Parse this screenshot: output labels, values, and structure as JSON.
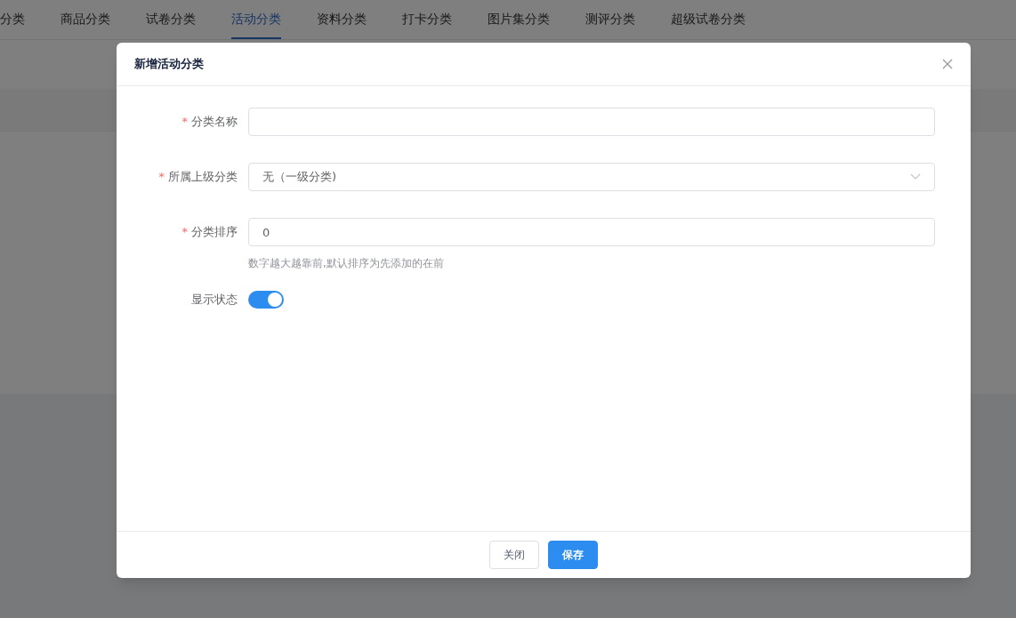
{
  "tabs": [
    {
      "label": "分类",
      "selected": false
    },
    {
      "label": "商品分类",
      "selected": false
    },
    {
      "label": "试卷分类",
      "selected": false
    },
    {
      "label": "活动分类",
      "selected": true
    },
    {
      "label": "资料分类",
      "selected": false
    },
    {
      "label": "打卡分类",
      "selected": false
    },
    {
      "label": "图片集分类",
      "selected": false
    },
    {
      "label": "测评分类",
      "selected": false
    },
    {
      "label": "超级试卷分类",
      "selected": false
    }
  ],
  "dialog": {
    "title": "新增活动分类",
    "fields": [
      {
        "kind": "text",
        "label": "分类名称",
        "required_mark": "*"
      },
      {
        "kind": "select",
        "label": "所属上级分类",
        "required_mark": "*",
        "value": "无（一级分类)"
      },
      {
        "kind": "text",
        "label": "分类排序",
        "required_mark": "*",
        "value": "0",
        "hint": "数字越大越靠前,默认排序为先添加的在前"
      },
      {
        "kind": "switch",
        "label": "显示状态",
        "on": true
      }
    ],
    "buttons": [
      {
        "label": "关闭",
        "kind": "default"
      },
      {
        "label": "保存",
        "kind": "primary"
      }
    ]
  }
}
